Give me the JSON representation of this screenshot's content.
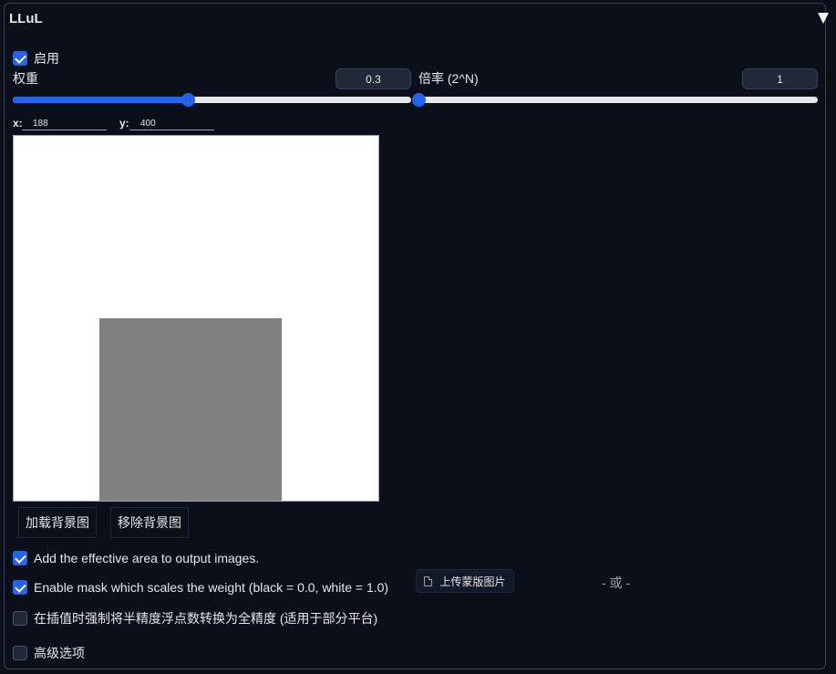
{
  "header": {
    "title": "LLuL"
  },
  "enable": {
    "label": "启用",
    "checked": true
  },
  "weight": {
    "label": "权重",
    "value": "0.3",
    "fraction": 0.439
  },
  "multiplier": {
    "label": "倍率 (2^N)",
    "value": "1",
    "fraction": 0.0
  },
  "coords": {
    "x_label": "x:",
    "x_value": "188",
    "y_label": "y:",
    "y_value": "400"
  },
  "canvas": {
    "background_color": "#ffffff",
    "mask_color": "#808080"
  },
  "buttons": {
    "load_bg": "加载背景图",
    "remove_bg": "移除背景图"
  },
  "options": {
    "add_effective_area": {
      "label": "Add the effective area to output images.",
      "checked": true
    },
    "enable_mask": {
      "label": "Enable mask which scales the weight (black = 0.0, white = 1.0)",
      "checked": true
    },
    "force_full_precision": {
      "label": "在插值时强制将半精度浮点数转换为全精度 (适用于部分平台)",
      "checked": false
    },
    "advanced": {
      "label": "高级选项",
      "checked": false
    }
  },
  "upload": {
    "label": "上传蒙版图片",
    "icon": "file-icon"
  },
  "or_text": "- 或 -",
  "colors": {
    "accent": "#2563eb",
    "background": "#0b0f19"
  }
}
